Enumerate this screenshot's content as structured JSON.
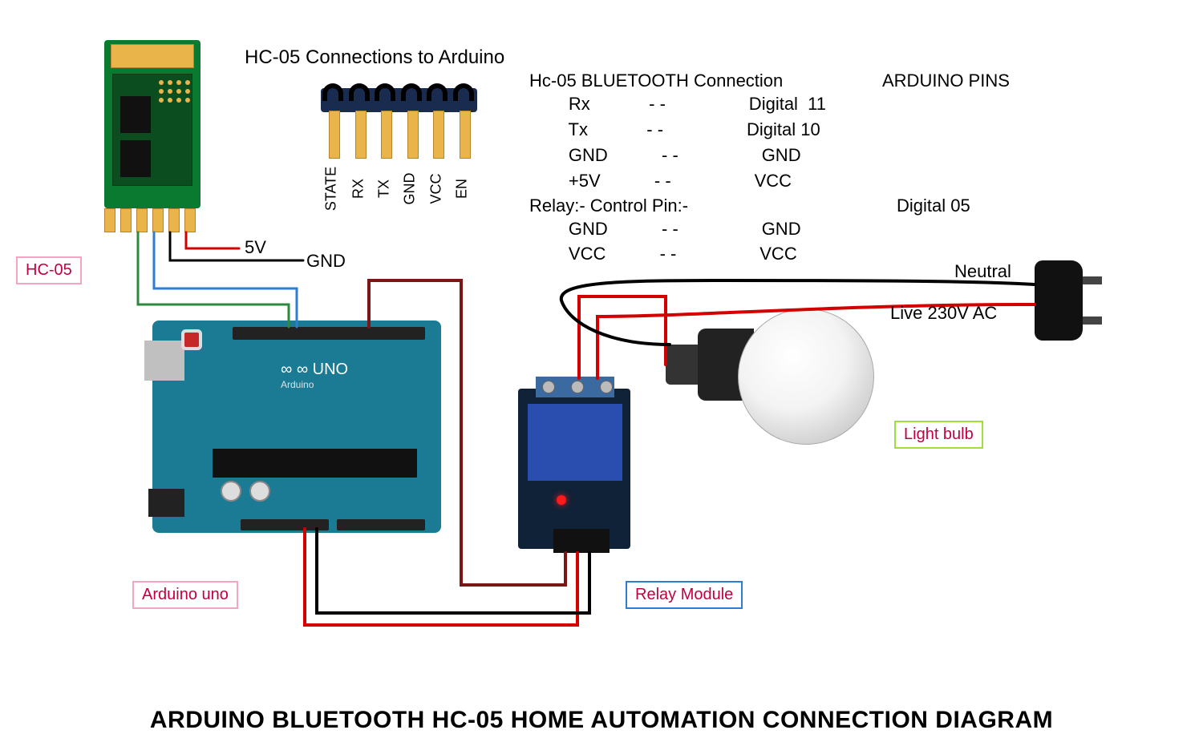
{
  "title": "ARDUINO BLUETOOTH HC-05 HOME AUTOMATION CONNECTION DIAGRAM",
  "hc05_heading": "HC-05 Connections to Arduino",
  "conn_table": {
    "col1_header": "Hc-05 BLUETOOTH Connection",
    "col2_header": "ARDUINO PINS",
    "rows": [
      {
        "left": "Rx",
        "sep": "- -",
        "right": "Digital  11"
      },
      {
        "left": "Tx",
        "sep": "- -",
        "right": "Digital 10"
      },
      {
        "left": "GND",
        "sep": "- -",
        "right": "GND"
      },
      {
        "left": "+5V",
        "sep": "- -",
        "right": "VCC"
      }
    ],
    "relay_header": "Relay:-   Control Pin:-",
    "relay_rows": [
      {
        "left": "",
        "right": "Digital  05"
      },
      {
        "left": "GND",
        "sep": "- -",
        "right": "GND"
      },
      {
        "left": "VCC",
        "sep": "- -",
        "right": "VCC"
      }
    ]
  },
  "hc05_pins": [
    "STATE",
    "RX",
    "TX",
    "GND",
    "VCC",
    "EN"
  ],
  "wire_labels": {
    "five_v": "5V",
    "gnd": "GND",
    "neutral": "Neutral",
    "live": "Live 230V AC"
  },
  "labels": {
    "hc05": "HC-05",
    "arduino": "Arduino uno",
    "relay": "Relay Module",
    "bulb": "Light bulb"
  },
  "arduino_logo_line1": "∞ ∞  UNO",
  "arduino_logo_line2": "Arduino"
}
